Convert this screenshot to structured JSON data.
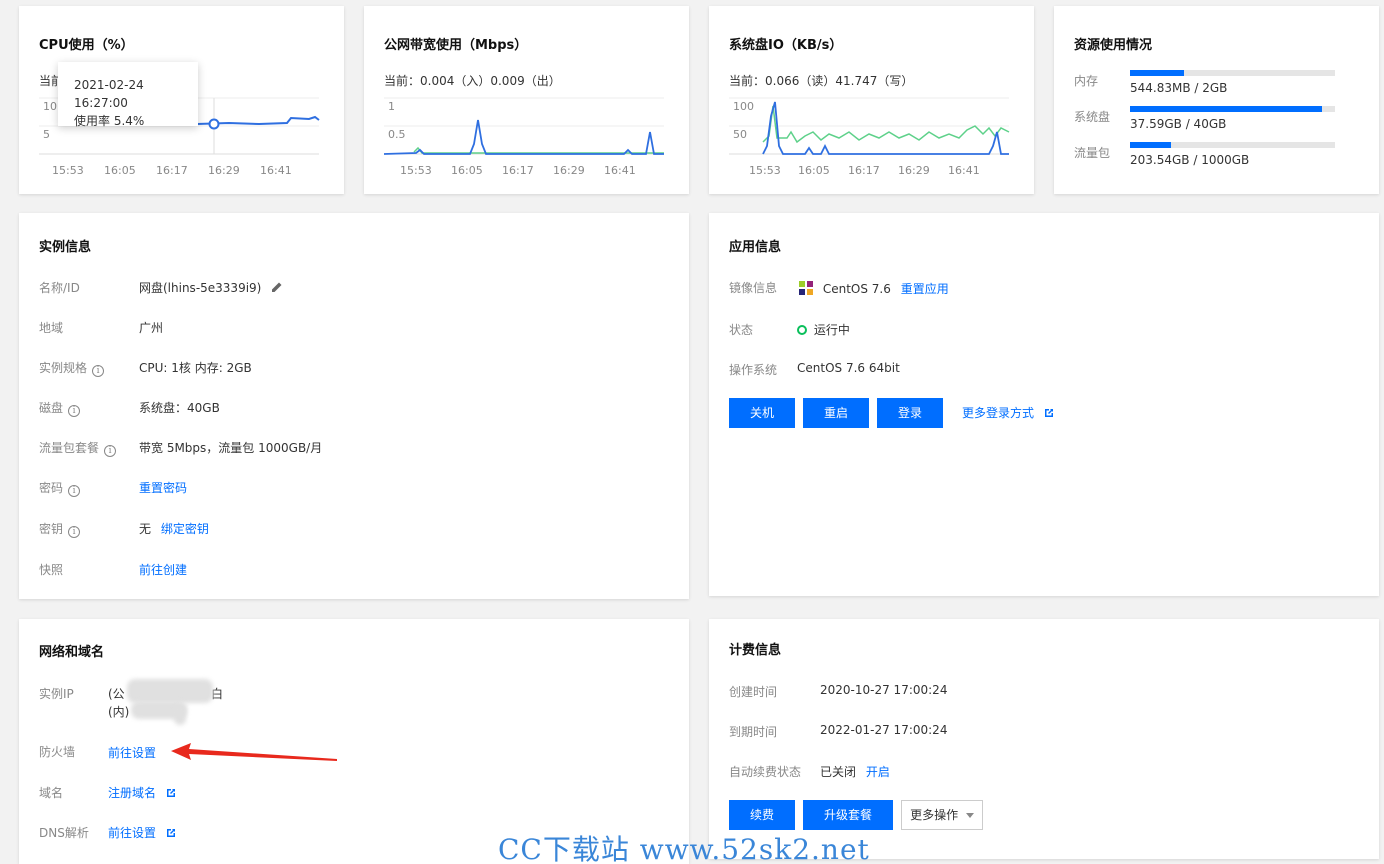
{
  "cpu": {
    "title": "CPU使用（%）",
    "current_prefix": "当前",
    "tooltip_time": "2021-02-24 16:27:00",
    "tooltip_value": "使用率 5.4%",
    "y_ticks": [
      "10",
      "5"
    ],
    "x_ticks": [
      "15:53",
      "16:05",
      "16:17",
      "16:29",
      "16:41"
    ]
  },
  "bandwidth": {
    "title": "公网带宽使用（Mbps）",
    "current": "当前：0.004（入）0.009（出）",
    "y_ticks": [
      "1",
      "0.5"
    ],
    "x_ticks": [
      "15:53",
      "16:05",
      "16:17",
      "16:29",
      "16:41"
    ]
  },
  "diskio": {
    "title": "系统盘IO（KB/s）",
    "current": "当前：0.066（读）41.747（写）",
    "y_ticks": [
      "100",
      "50"
    ],
    "x_ticks": [
      "15:53",
      "16:05",
      "16:17",
      "16:29",
      "16:41"
    ]
  },
  "resources": {
    "title": "资源使用情况",
    "items": [
      {
        "label": "内存",
        "value": "544.83MB / 2GB",
        "fraction": 0.266
      },
      {
        "label": "系统盘",
        "value": "37.59GB / 40GB",
        "fraction": 0.94
      },
      {
        "label": "流量包",
        "value": "203.54GB / 1000GB",
        "fraction": 0.2035
      }
    ]
  },
  "instance": {
    "title": "实例信息",
    "name_label": "名称/ID",
    "name_value": "网盘(lhins-5e3339i9)",
    "region_label": "地域",
    "region_value": "广州",
    "spec_label": "实例规格",
    "spec_value": "CPU: 1核 内存: 2GB",
    "disk_label": "磁盘",
    "disk_value": "系统盘：40GB",
    "traffic_label": "流量包套餐",
    "traffic_value": "带宽 5Mbps，流量包 1000GB/月",
    "password_label": "密码",
    "password_link": "重置密码",
    "key_label": "密钥",
    "key_value": "无",
    "key_link": "绑定密钥",
    "snapshot_label": "快照",
    "snapshot_link": "前往创建"
  },
  "app": {
    "title": "应用信息",
    "image_label": "镜像信息",
    "image_value": "CentOS 7.6",
    "image_link": "重置应用",
    "status_label": "状态",
    "status_value": "运行中",
    "os_label": "操作系统",
    "os_value": "CentOS 7.6 64bit",
    "btn_shutdown": "关机",
    "btn_restart": "重启",
    "btn_login": "登录",
    "more_login": "更多登录方式"
  },
  "network": {
    "title": "网络和域名",
    "ip_label": "实例IP",
    "ip_public_prefix": "(公",
    "ip_public_suffix": "白",
    "ip_private_prefix": "(内)",
    "firewall_label": "防火墙",
    "firewall_link": "前往设置",
    "domain_label": "域名",
    "domain_link": "注册域名",
    "dns_label": "DNS解析",
    "dns_link": "前往设置"
  },
  "billing": {
    "title": "计费信息",
    "created_label": "创建时间",
    "created_value": "2020-10-27 17:00:24",
    "expire_label": "到期时间",
    "expire_value": "2022-01-27 17:00:24",
    "auto_label": "自动续费状态",
    "auto_value": "已关闭",
    "auto_link": "开启",
    "btn_renew": "续费",
    "btn_upgrade": "升级套餐",
    "btn_more": "更多操作"
  },
  "watermark": "CC下载站 www.52sk2.net",
  "colors": {
    "accent": "#006eff",
    "green": "#5ed18a",
    "status": "#0abf5b",
    "arrow": "#e8291d"
  }
}
